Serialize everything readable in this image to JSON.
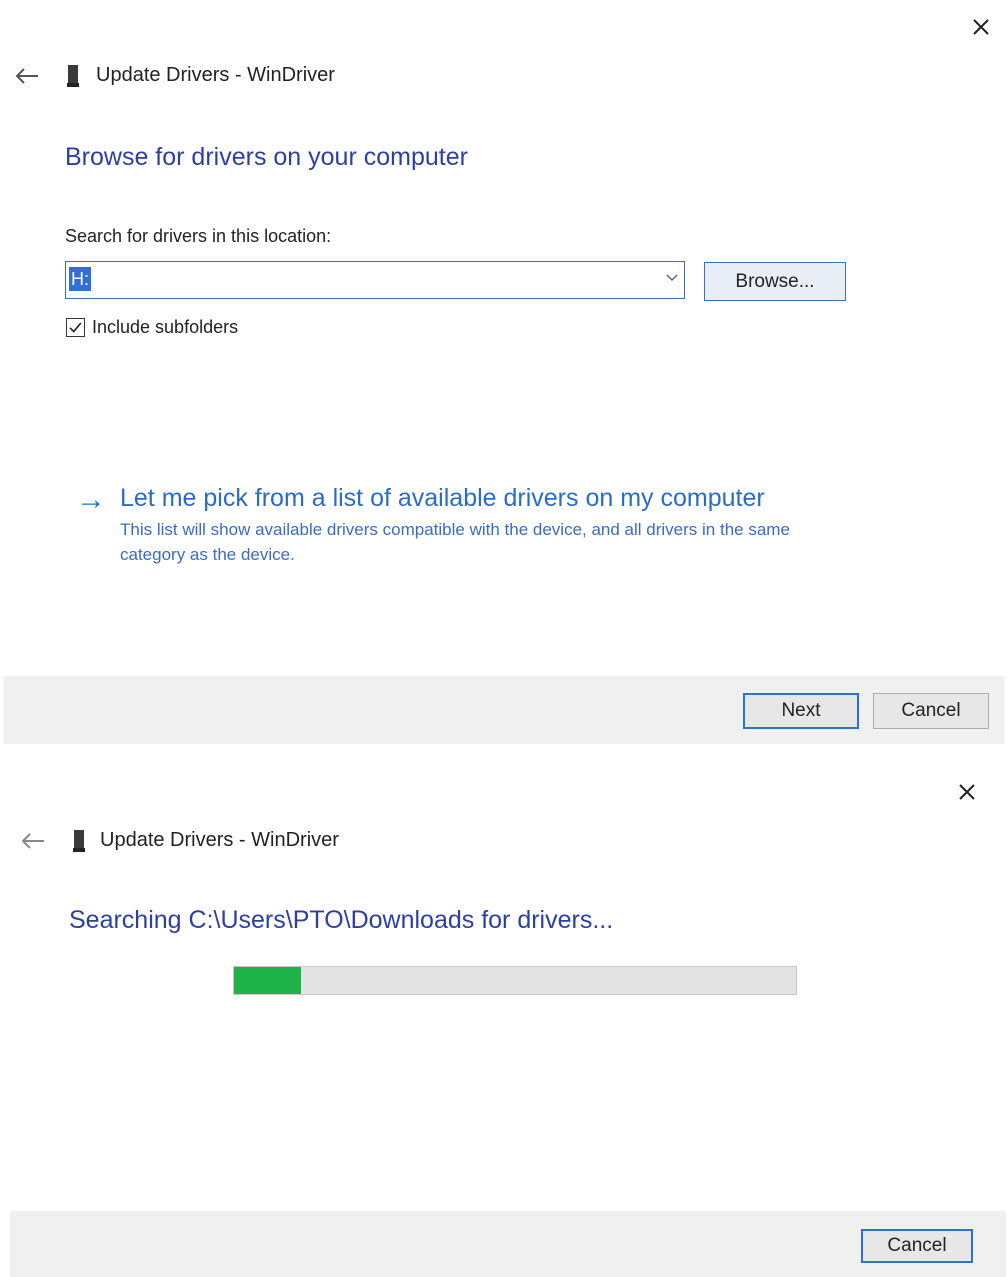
{
  "dialog1": {
    "title": "Update Drivers - WinDriver",
    "heading": "Browse for drivers on your computer",
    "search_label": "Search for drivers in this location:",
    "location_value": "H:",
    "browse_label": "Browse...",
    "include_subfolders_label": "Include subfolders",
    "include_subfolders_checked": true,
    "pick_link_title": "Let me pick from a list of available drivers on my computer",
    "pick_link_description": "This list will show available drivers compatible with the device, and all drivers in the same category as the device.",
    "next_label": "Next",
    "cancel_label": "Cancel"
  },
  "dialog2": {
    "title": "Update Drivers - WinDriver",
    "heading": "Searching C:\\Users\\PTO\\Downloads for drivers...",
    "progress_fraction": 0.12,
    "cancel_label": "Cancel"
  },
  "colors": {
    "heading": "#2d3fa3",
    "link": "#2b6cc4",
    "progress": "#1fb34a",
    "focus_border": "#2f6fd6"
  },
  "icons": [
    "close-icon",
    "back-arrow-icon",
    "device-icon",
    "chevron-down-icon",
    "checkmark-icon",
    "right-arrow-icon"
  ]
}
